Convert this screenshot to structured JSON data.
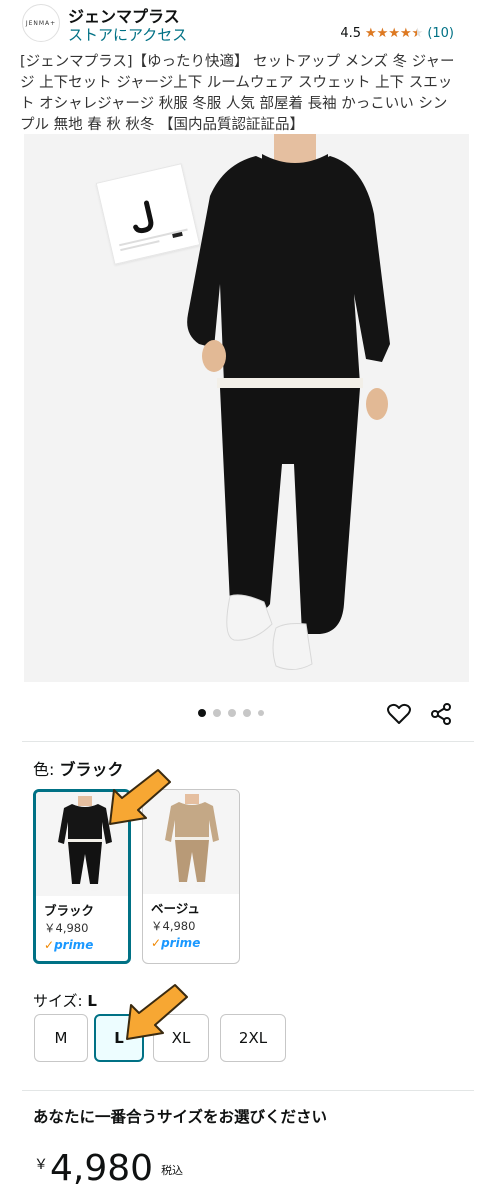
{
  "header": {
    "brand_logo_text": "JENMA+",
    "brand_name": "ジェンマプラス",
    "store_link": "ストアにアクセス",
    "rating_value": "4.5",
    "rating_count": "(10)",
    "rating_fraction": 0.9
  },
  "product": {
    "title": "[ジェンマプラス]【ゆったり快適】 セットアップ メンズ 冬 ジャージ 上下セット ジャージ上下 ルームウェア スウェット 上下 スエット オシャレジャージ 秋服 冬服 人気 部屋着 長袖 かっこいい シンプル 無地 春 秋 秋冬 【国内品質認証証品】",
    "carousel": {
      "current": 1,
      "total": 5
    }
  },
  "color": {
    "label": "色:",
    "selected": "ブラック",
    "options": [
      {
        "name": "ブラック",
        "price": "￥4,980",
        "prime": "prime",
        "selected": true
      },
      {
        "name": "ベージュ",
        "price": "￥4,980",
        "prime": "prime",
        "selected": false
      }
    ]
  },
  "size": {
    "label": "サイズ:",
    "selected": "L",
    "options": [
      "M",
      "L",
      "XL",
      "2XL"
    ]
  },
  "fit_message": "あなたに一番合うサイズをお選びください",
  "price": {
    "currency": "￥",
    "amount": "4,980",
    "tax_note": "税込"
  },
  "colors": {
    "link": "#007185",
    "star": "#de7921",
    "selected_border": "#007185",
    "arrow": "#f7a733",
    "prime": "#1a98ff"
  },
  "icons": {
    "wishlist": "heart-icon",
    "share": "share-icon",
    "annotation": "arrow-icon"
  }
}
